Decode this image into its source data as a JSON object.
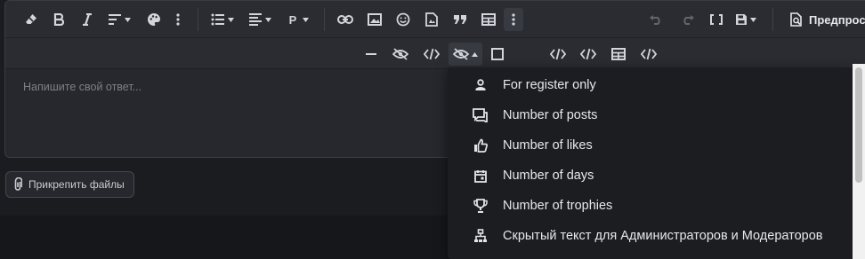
{
  "toolbar": {
    "row1": [
      {
        "name": "eraser-button",
        "icon": "eraser-icon"
      },
      {
        "name": "bold-button",
        "icon": "bold-icon"
      },
      {
        "name": "italic-button",
        "icon": "italic-icon"
      },
      {
        "name": "text-style-button",
        "icon": "text-style-icon"
      },
      {
        "name": "color-palette-button",
        "icon": "palette-icon"
      },
      {
        "name": "more-text-button",
        "icon": "more-vertical-icon"
      },
      {
        "name": "list-button",
        "icon": "list-icon"
      },
      {
        "name": "align-button",
        "icon": "align-left-icon"
      },
      {
        "name": "paragraph-button",
        "icon": "paragraph-icon"
      },
      {
        "name": "link-button",
        "icon": "link-icon"
      },
      {
        "name": "image-button",
        "icon": "image-icon"
      },
      {
        "name": "emoji-button",
        "icon": "smile-icon"
      },
      {
        "name": "media-button",
        "icon": "media-file-icon"
      },
      {
        "name": "quote-button",
        "icon": "quote-icon"
      },
      {
        "name": "table-button",
        "icon": "table-icon"
      },
      {
        "name": "more-insert-button",
        "icon": "more-vertical-icon"
      },
      {
        "name": "undo-button",
        "icon": "undo-icon"
      },
      {
        "name": "redo-button",
        "icon": "redo-icon"
      },
      {
        "name": "toggle-bbcode-button",
        "icon": "brackets-icon"
      },
      {
        "name": "drafts-button",
        "icon": "save-icon"
      }
    ],
    "row2": [
      {
        "name": "horizontal-rule-button",
        "icon": "minus-icon"
      },
      {
        "name": "hide-button",
        "icon": "eye-off-icon"
      },
      {
        "name": "code-button",
        "icon": "code-icon"
      },
      {
        "name": "hide-options-button",
        "icon": "eye-off-icon"
      },
      {
        "name": "spoiler-button",
        "icon": "square-icon"
      },
      {
        "name": "inline-code-button",
        "icon": "code-icon"
      },
      {
        "name": "html-button",
        "icon": "code-icon"
      },
      {
        "name": "table-insert-button",
        "icon": "table-icon"
      },
      {
        "name": "embed-button",
        "icon": "code-icon"
      }
    ],
    "paragraph_label": "P",
    "preview_label": "Предпрос"
  },
  "editor": {
    "placeholder": "Напишите свой ответ..."
  },
  "attach": {
    "label": "Прикрепить файлы",
    "icon": "paperclip-icon"
  },
  "dropdown": {
    "items": [
      {
        "label": "For register only",
        "icon": "user-icon"
      },
      {
        "label": "Number of posts",
        "icon": "comments-icon"
      },
      {
        "label": "Number of likes",
        "icon": "thumbs-up-icon"
      },
      {
        "label": "Number of days",
        "icon": "calendar-icon"
      },
      {
        "label": "Number of trophies",
        "icon": "trophy-icon"
      },
      {
        "label": "Скрытый текст для Администраторов и Модераторов",
        "icon": "sitemap-icon"
      }
    ]
  },
  "colors": {
    "background": "#1b1c20",
    "toolbar": "#2a2c32",
    "dropdown": "#1c1d21",
    "text": "#e6e8ec",
    "muted": "#7d8087"
  }
}
